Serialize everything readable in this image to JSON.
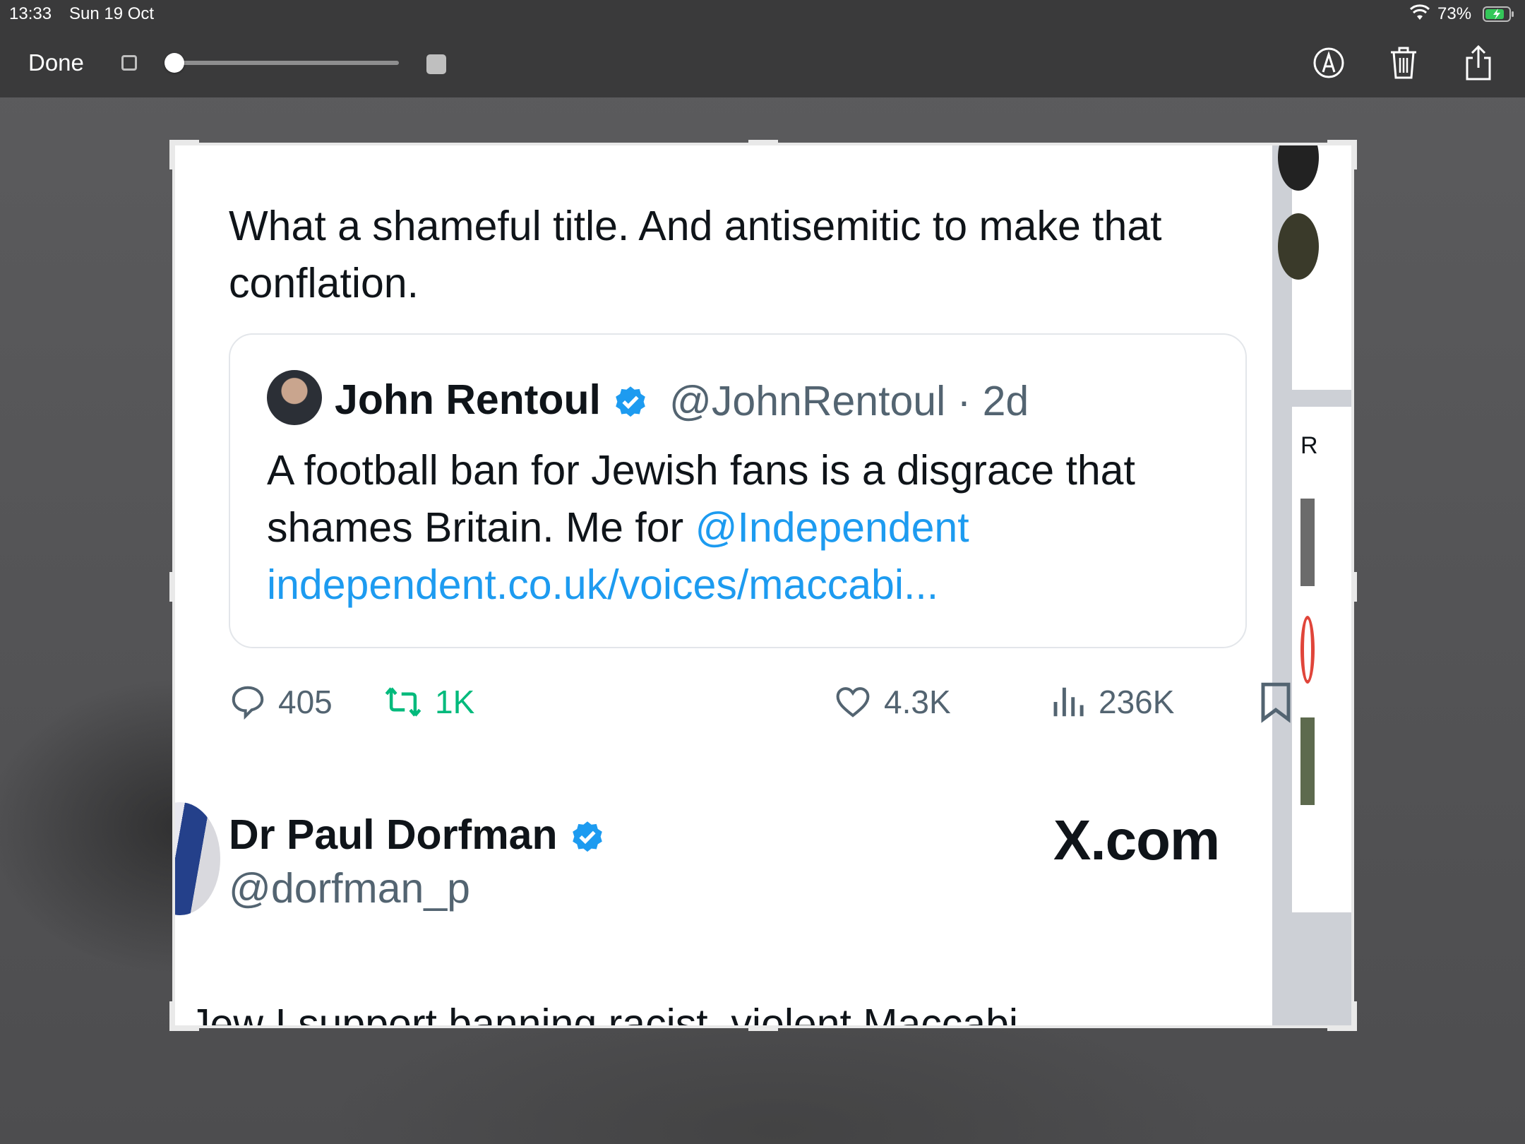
{
  "status_bar": {
    "time": "13:33",
    "date": "Sun 19 Oct",
    "battery_percent": "73%",
    "wifi_icon": "wifi-icon",
    "battery_icon": "battery-charging-icon"
  },
  "toolbar": {
    "done_label": "Done",
    "slider_value": 0.0,
    "icons": [
      "markup-icon",
      "trash-icon",
      "share-icon"
    ]
  },
  "tweet": {
    "text": "What a shameful title. And antisemitic to make that conflation.",
    "quote": {
      "author_name": "John Rentoul",
      "handle_time": "@JohnRentoul · 2d",
      "body_prefix": "A football ban for Jewish fans is a disgrace that shames Britain. Me for ",
      "mention": "@Independent",
      "link": "independent.co.uk/voices/maccabi..."
    },
    "actions": {
      "replies": "405",
      "reposts": "1K",
      "likes": "4.3K",
      "views": "236K"
    },
    "colors": {
      "link": "#1d9bf0",
      "repost": "#00ba7c",
      "verified": "#1d9bf0"
    }
  },
  "next_tweet": {
    "author_name": "Dr Paul Dorfman",
    "handle": "@dorfman_p",
    "watermark": "X.com",
    "partial_text": "Jew I support banning racist, violent Maccabi"
  },
  "sidebar": {
    "partial_letter": "R"
  }
}
